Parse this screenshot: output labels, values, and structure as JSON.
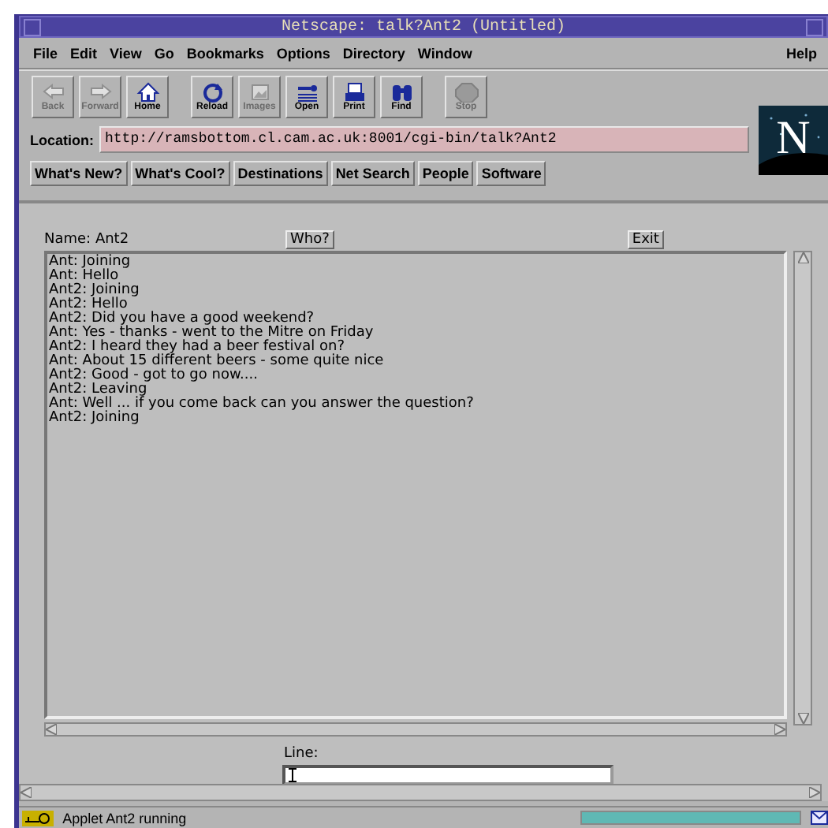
{
  "window": {
    "title": "Netscape: talk?Ant2 (Untitled)"
  },
  "menu": [
    "File",
    "Edit",
    "View",
    "Go",
    "Bookmarks",
    "Options",
    "Directory",
    "Window"
  ],
  "help_menu": "Help",
  "toolbar": [
    {
      "label": "Back",
      "disabled": true
    },
    {
      "label": "Forward",
      "disabled": true
    },
    {
      "label": "Home",
      "disabled": false
    },
    {
      "label": "Reload",
      "disabled": false
    },
    {
      "label": "Images",
      "disabled": true
    },
    {
      "label": "Open",
      "disabled": false
    },
    {
      "label": "Print",
      "disabled": false
    },
    {
      "label": "Find",
      "disabled": false
    },
    {
      "label": "Stop",
      "disabled": true
    }
  ],
  "location": {
    "label": "Location:",
    "value": "http://ramsbottom.cl.cam.ac.uk:8001/cgi-bin/talk?Ant2"
  },
  "logo": {
    "letter": "N"
  },
  "directory_buttons": [
    "What's New?",
    "What's Cool?",
    "Destinations",
    "Net Search",
    "People",
    "Software"
  ],
  "applet": {
    "name_label": "Name: Ant2",
    "who_button": "Who?",
    "exit_button": "Exit",
    "messages": [
      "Ant: Joining",
      "Ant: Hello",
      "Ant2: Joining",
      "Ant2: Hello",
      "Ant2: Did you have a good weekend?",
      "Ant: Yes - thanks - went to the Mitre on Friday",
      "Ant2: I heard they had a beer festival on?",
      "Ant: About 15 different beers - some quite nice",
      "Ant2: Good - got to go now....",
      "Ant2: Leaving",
      "Ant: Well ... if you come back can you answer the question?",
      "Ant2: Joining"
    ],
    "line_label": "Line:"
  },
  "status_bar": {
    "text": "Applet Ant2 running",
    "progress": {
      "level": 1
    }
  }
}
